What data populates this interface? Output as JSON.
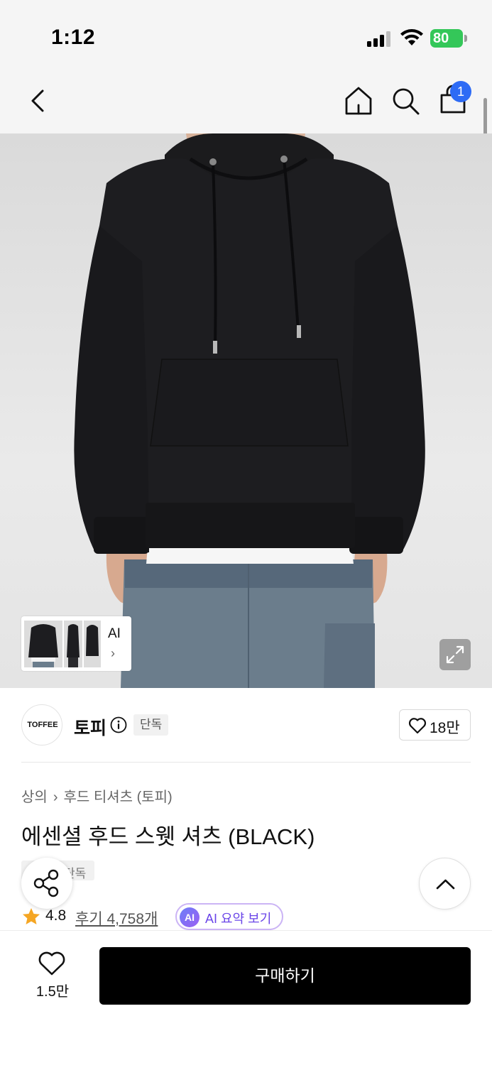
{
  "status_bar": {
    "time": "1:12",
    "battery_percent": "80",
    "icons": [
      "cellular-signal-icon",
      "wifi-icon",
      "battery-charging-icon"
    ]
  },
  "nav": {
    "icons": [
      "chevron-left-icon",
      "home-icon",
      "search-icon",
      "shopping-bag-icon"
    ],
    "cart_count": "1"
  },
  "gallery": {
    "ai_label": "AI",
    "chevron": "›"
  },
  "brand": {
    "logo_text": "TOFFEE",
    "name": "토피",
    "badge": "단독",
    "like_count": "18만"
  },
  "product": {
    "breadcrumb": [
      "상의",
      "후드 티셔츠 (토피)"
    ],
    "breadcrumb_sep": "›",
    "title": "에센셜 후드 스웻 셔츠 (BLACK)",
    "tag": "단독",
    "rating": "4.8",
    "review_label": "후기 4,758개",
    "ai_badge": "AI",
    "ai_summary_label": "AI 요약 보기"
  },
  "bottom": {
    "wish_count": "1.5만",
    "buy_label": "구매하기"
  },
  "colors": {
    "accent_blue": "#2d6bf5",
    "battery_green": "#34c759",
    "star_orange": "#f5a623",
    "ai_purple": "#6a45e8",
    "buy_black": "#000000"
  }
}
